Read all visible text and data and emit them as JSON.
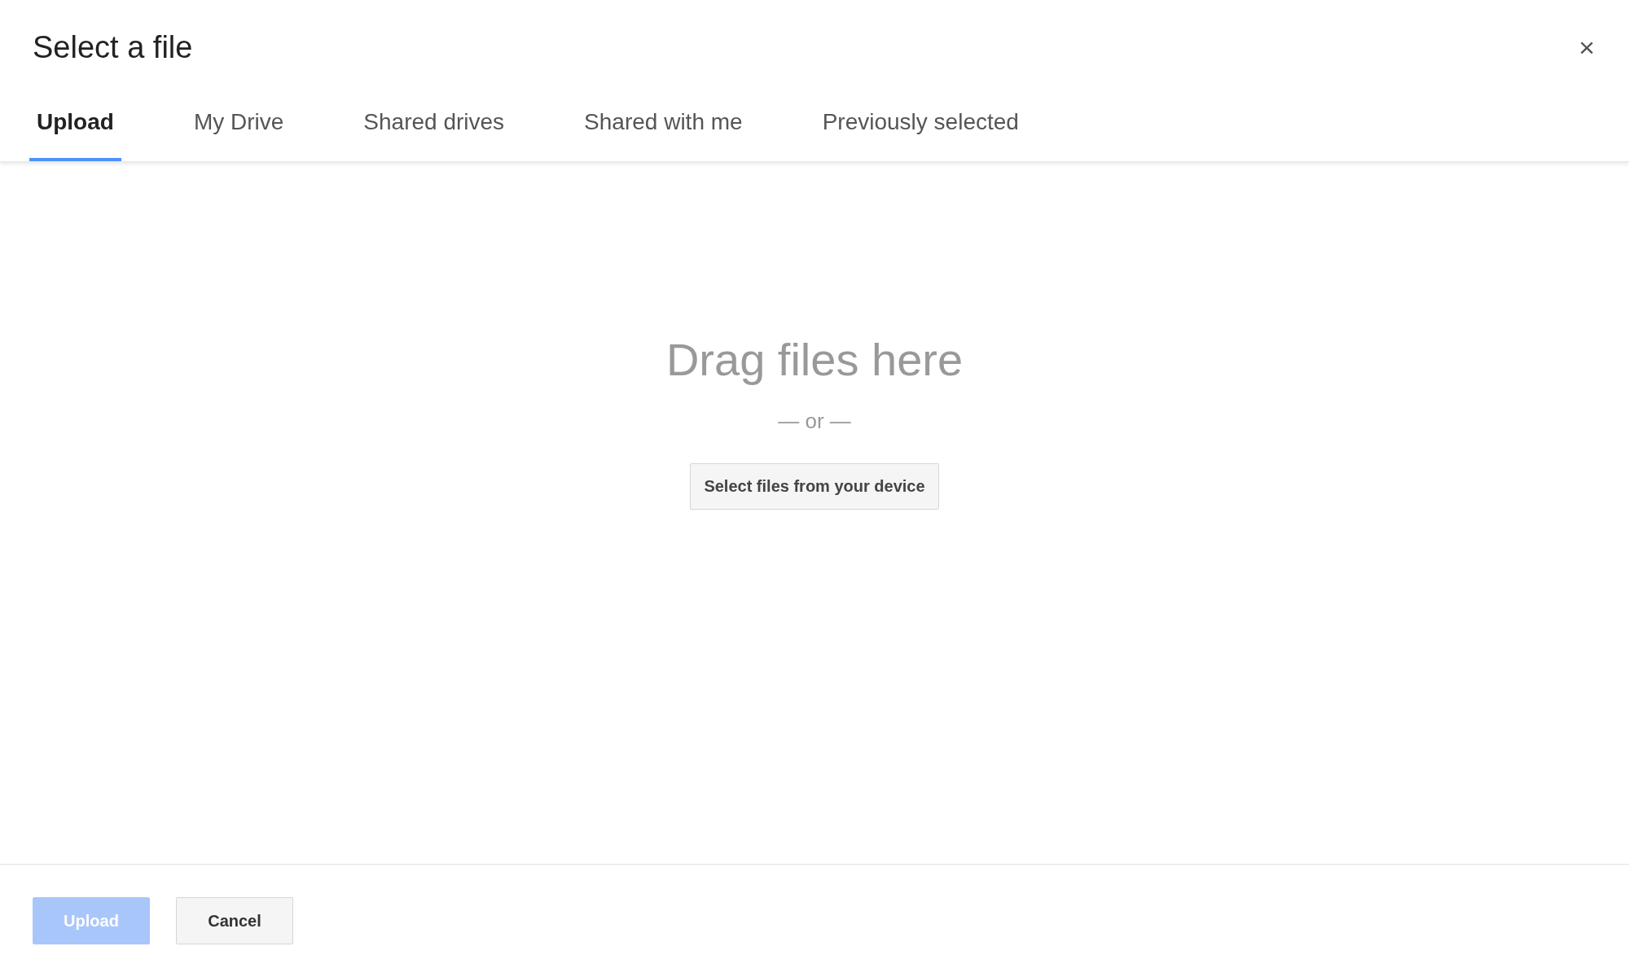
{
  "dialog": {
    "title": "Select a file",
    "close_label": "×"
  },
  "tabs": [
    {
      "label": "Upload",
      "selected": true
    },
    {
      "label": "My Drive",
      "selected": false
    },
    {
      "label": "Shared drives",
      "selected": false
    },
    {
      "label": "Shared with me",
      "selected": false
    },
    {
      "label": "Previously selected",
      "selected": false
    }
  ],
  "drop_zone": {
    "heading": "Drag files here",
    "separator": "— or —",
    "button": "Select files from your device"
  },
  "footer": {
    "buttons": [
      {
        "label": "Upload",
        "kind": "primary",
        "disabled": true
      },
      {
        "label": "Cancel",
        "kind": "secondary",
        "disabled": false
      }
    ]
  }
}
